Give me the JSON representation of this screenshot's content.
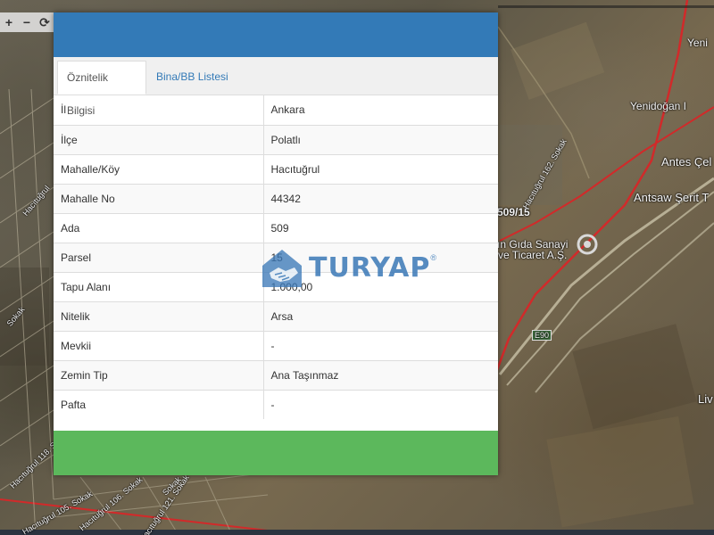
{
  "map": {
    "labels": [
      "Yeni",
      "Yenidoğan I",
      "Antes Çel",
      "Antsaw Şerit T",
      "509/15",
      "ın Gıda Sanayi",
      "ve Ticaret A.Ş.",
      "E90",
      "Liv",
      "Hacıtuğrul 162. Sokak",
      "Hacıtuğrul",
      "Sokak",
      "Hacıtuğrul 105. Sokak",
      "Hacıtuğrul 106. Sokak",
      "Hacıtuğrul 121. Sokak",
      "Hacıtuğrul 118. Sokak",
      "Sokak"
    ],
    "controls": [
      "+",
      "−",
      "⟳"
    ]
  },
  "panel": {
    "tabs": [
      {
        "label": "Öznitelik Bilgisi",
        "active": true
      },
      {
        "label": "Bina/BB Listesi",
        "active": false
      }
    ],
    "rows": [
      {
        "key": "İl",
        "value": "Ankara"
      },
      {
        "key": "İlçe",
        "value": "Polatlı"
      },
      {
        "key": "Mahalle/Köy",
        "value": "Hacıtuğrul"
      },
      {
        "key": "Mahalle No",
        "value": "44342"
      },
      {
        "key": "Ada",
        "value": "509"
      },
      {
        "key": "Parsel",
        "value": "15"
      },
      {
        "key": "Tapu Alanı",
        "value": "1.000,00"
      },
      {
        "key": "Nitelik",
        "value": "Arsa"
      },
      {
        "key": "Mevkii",
        "value": "-"
      },
      {
        "key": "Zemin Tip",
        "value": "Ana Taşınmaz"
      },
      {
        "key": "Pafta",
        "value": "-"
      }
    ],
    "colors": {
      "header": "#337ab7",
      "footer": "#5cb85c",
      "tab_link": "#337ab7"
    }
  },
  "watermark": {
    "text": "TURYAP",
    "registered": "®",
    "icon": "handshake-house-icon"
  }
}
